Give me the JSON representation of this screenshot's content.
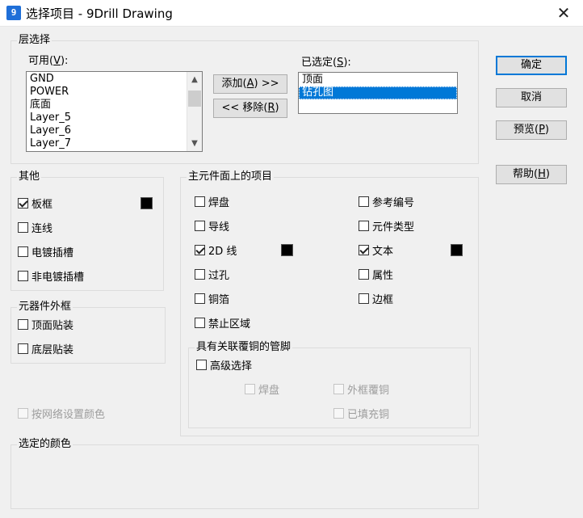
{
  "window": {
    "title": "选择项目 - 9Drill Drawing",
    "app_icon": "9"
  },
  "layers": {
    "group_label": "层选择",
    "available_label": "可用(V):",
    "available_items": [
      "GND",
      "POWER",
      "底面",
      "Layer_5",
      "Layer_6",
      "Layer_7"
    ],
    "selected_label": "已选定(S):",
    "selected_items": [
      "顶面",
      "钻孔图"
    ],
    "add_button": "添加(A) >>",
    "remove_button": "<< 移除(R)"
  },
  "dialog_buttons": {
    "ok": "确定",
    "cancel": "取消",
    "preview": "预览(P)",
    "help": "帮助(H)"
  },
  "other": {
    "group_label": "其他",
    "board": {
      "label": "板框",
      "checked": true,
      "color": "#000000"
    },
    "connections": {
      "label": "连线",
      "checked": false
    },
    "plated_slots": {
      "label": "电镀插槽",
      "checked": false
    },
    "nonplated_slots": {
      "label": "非电镀插槽",
      "checked": false
    }
  },
  "component_outline": {
    "group_label": "元器件外框",
    "top_mount": {
      "label": "顶面贴装",
      "checked": false
    },
    "bottom_mount": {
      "label": "底层贴装",
      "checked": false
    }
  },
  "net_color": {
    "label": "按网络设置颜色",
    "checked": false,
    "disabled": true
  },
  "primary_items": {
    "group_label": "主元件面上的项目",
    "pads": {
      "label": "焊盘",
      "checked": false
    },
    "traces": {
      "label": "导线",
      "checked": false
    },
    "lines_2d": {
      "label": "2D 线",
      "checked": true,
      "color": "#000000"
    },
    "vias": {
      "label": "过孔",
      "checked": false
    },
    "copper": {
      "label": "铜箔",
      "checked": false
    },
    "keepout": {
      "label": "禁止区域",
      "checked": false
    },
    "ref_des": {
      "label": "参考编号",
      "checked": false
    },
    "part_type": {
      "label": "元件类型",
      "checked": false
    },
    "text": {
      "label": "文本",
      "checked": true,
      "color": "#000000"
    },
    "attributes": {
      "label": "属性",
      "checked": false
    },
    "outline": {
      "label": "边框",
      "checked": false
    }
  },
  "pins_with_copper": {
    "group_label": "具有关联覆铜的管脚",
    "advanced": {
      "label": "高级选择",
      "checked": false
    },
    "pads": {
      "label": "焊盘",
      "checked": false,
      "disabled": true
    },
    "outline_copper": {
      "label": "外框覆铜",
      "checked": false,
      "disabled": true
    },
    "filled_copper": {
      "label": "已填充铜",
      "checked": false,
      "disabled": true
    }
  },
  "selected_colors": {
    "group_label": "选定的颜色"
  }
}
